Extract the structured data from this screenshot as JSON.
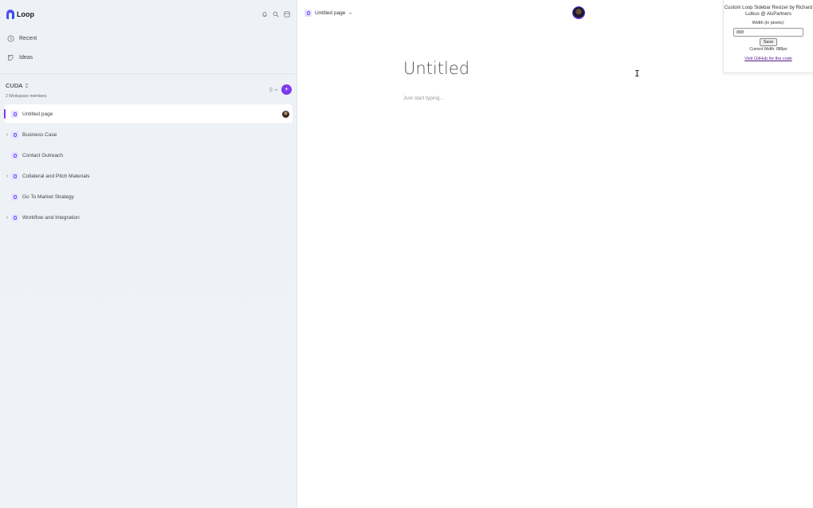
{
  "app": {
    "name": "Loop"
  },
  "sidebar": {
    "top_icons": [
      "bell-icon",
      "search-icon",
      "layout-icon"
    ],
    "nav": [
      {
        "label": "Recent",
        "icon": "clock-icon"
      },
      {
        "label": "Ideas",
        "icon": "lightbulb-icon"
      }
    ],
    "workspace": {
      "name": "CUDA",
      "members": "2 Workspace members",
      "add_icon": "+"
    },
    "pages": [
      {
        "label": "Untitled page",
        "active": true,
        "expandable": false,
        "has_avatar": true
      },
      {
        "label": "Business Case",
        "active": false,
        "expandable": true,
        "has_avatar": false
      },
      {
        "label": "Contact Outreach",
        "active": false,
        "expandable": false,
        "has_avatar": false
      },
      {
        "label": "Collateral and Pitch Materials",
        "active": false,
        "expandable": true,
        "has_avatar": false
      },
      {
        "label": "Go To Market Strategy",
        "active": false,
        "expandable": false,
        "has_avatar": false
      },
      {
        "label": "Workflow and Integration",
        "active": false,
        "expandable": true,
        "has_avatar": false
      }
    ]
  },
  "main": {
    "breadcrumb": "Untitled page",
    "title": "Untitled",
    "placeholder": "Just start typing..."
  },
  "extension": {
    "title": "Custom Loop Sidebar Resizer by Richard Lutkus @ AlsPartners",
    "width_label": "Width (in pixels):",
    "width_value": "888",
    "save_label": "Save",
    "current": "Current Width: 888px",
    "link": "Visit GitHub for the code"
  },
  "colors": {
    "accent": "#7c3aed",
    "sidebar_bg": "#eef1f6"
  }
}
